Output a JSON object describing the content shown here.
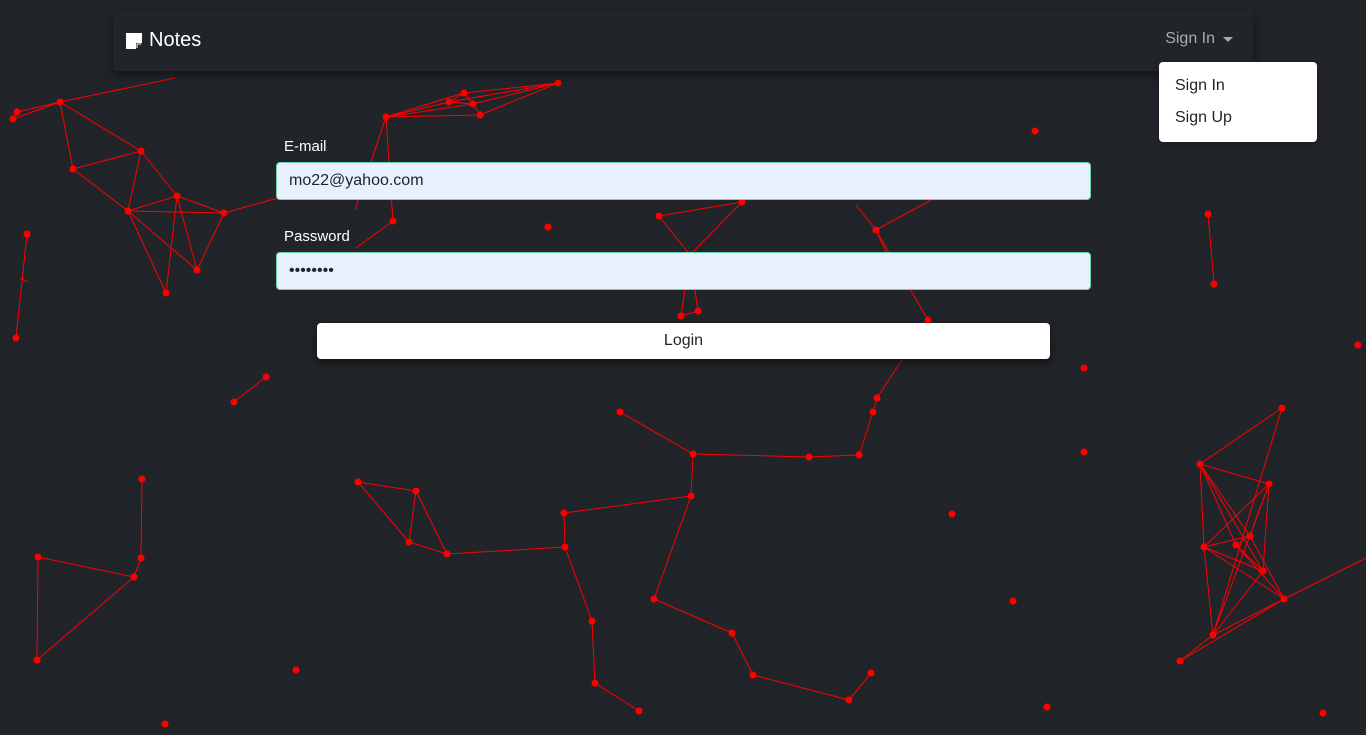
{
  "navbar": {
    "brand": "Notes",
    "brand_icon": "sticky-note-icon",
    "dropdown_label": "Sign In"
  },
  "dropdown": {
    "items": [
      "Sign In",
      "Sign Up"
    ]
  },
  "form": {
    "email_label": "E-mail",
    "email_value": "mo22@yahoo.com",
    "password_label": "Password",
    "password_value": "password",
    "submit_label": "Login"
  },
  "colors": {
    "background": "#212429",
    "network_lines": "#ff0000",
    "input_fill": "#e8f0fe",
    "input_border": "#6cd3b2"
  }
}
